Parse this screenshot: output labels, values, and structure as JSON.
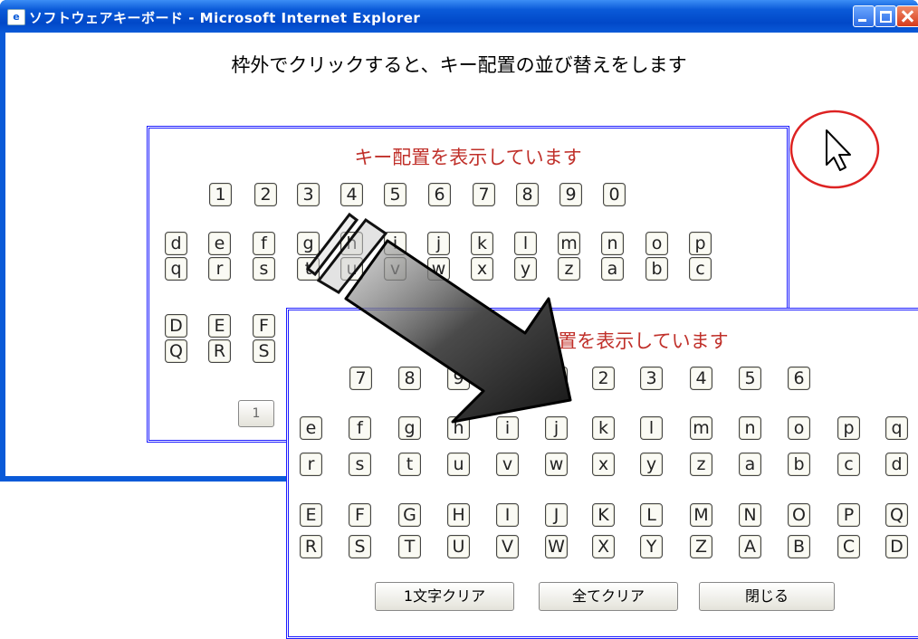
{
  "window": {
    "title": "ソフトウェアキーボード - Microsoft Internet Explorer",
    "icon": "ie-page-icon",
    "controls": [
      "minimize-icon",
      "maximize-icon",
      "close-icon"
    ]
  },
  "instruction": "枠外でクリックすると、キー配置の並び替えをします",
  "panel_back": {
    "title": "キー配置を表示しています",
    "digits": [
      "1",
      "2",
      "3",
      "4",
      "5",
      "6",
      "7",
      "8",
      "9",
      "0"
    ],
    "lower_row1": [
      "d",
      "e",
      "f",
      "g",
      "h",
      "i",
      "j",
      "k",
      "l",
      "m",
      "n",
      "o",
      "p"
    ],
    "lower_row2": [
      "q",
      "r",
      "s",
      "t",
      "u",
      "v",
      "w",
      "x",
      "y",
      "z",
      "a",
      "b",
      "c"
    ],
    "upper_row1": [
      "D",
      "E",
      "F"
    ],
    "upper_row2": [
      "Q",
      "R",
      "S"
    ],
    "clear_one_partial": "1"
  },
  "panel_front": {
    "title": "キー配置を表示しています",
    "digits": [
      "7",
      "8",
      "9",
      "0",
      "1",
      "2",
      "3",
      "4",
      "5",
      "6"
    ],
    "lower_row1": [
      "e",
      "f",
      "g",
      "h",
      "i",
      "j",
      "k",
      "l",
      "m",
      "n",
      "o",
      "p",
      "q"
    ],
    "lower_row2": [
      "r",
      "s",
      "t",
      "u",
      "v",
      "w",
      "x",
      "y",
      "z",
      "a",
      "b",
      "c",
      "d"
    ],
    "upper_row1": [
      "E",
      "F",
      "G",
      "H",
      "I",
      "J",
      "K",
      "L",
      "M",
      "N",
      "O",
      "P",
      "Q"
    ],
    "upper_row2": [
      "R",
      "S",
      "T",
      "U",
      "V",
      "W",
      "X",
      "Y",
      "Z",
      "A",
      "B",
      "C",
      "D"
    ],
    "buttons": {
      "clear_one": "1文字クリア",
      "clear_all": "全てクリア",
      "close": "閉じる"
    }
  },
  "annotation": {
    "arrow_color": "#202020",
    "circle_color": "#dd2222",
    "cursor_icon": "mouse-pointer-icon"
  }
}
